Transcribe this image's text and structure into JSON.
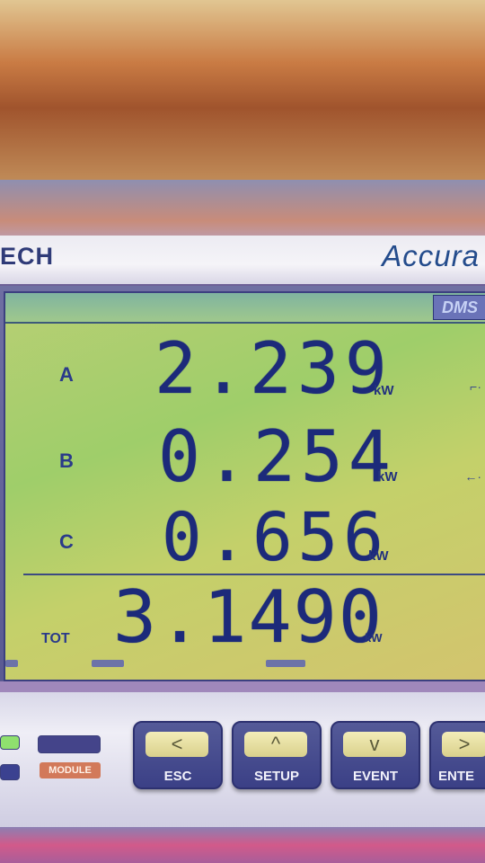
{
  "device": {
    "brand_left": "ECH",
    "brand_right": "Accura",
    "badge": "DMS"
  },
  "readings": [
    {
      "phase": "A",
      "value": "2.239",
      "unit": "kW"
    },
    {
      "phase": "B",
      "value": "0.254",
      "unit": "kW"
    },
    {
      "phase": "C",
      "value": "0.656",
      "unit": "kW"
    }
  ],
  "total": {
    "label": "TOT",
    "value": "3.1490",
    "unit": "kW"
  },
  "buttons": {
    "module_label": "MODULE",
    "esc": {
      "label": "ESC",
      "icon": "chevron-left-icon",
      "glyph": "<"
    },
    "setup": {
      "label": "SETUP",
      "icon": "chevron-up-icon",
      "glyph": "^"
    },
    "event": {
      "label": "EVENT",
      "icon": "chevron-down-icon",
      "glyph": "v"
    },
    "enter": {
      "label": "ENTE",
      "icon": "chevron-right-icon",
      "glyph": ">"
    }
  },
  "colors": {
    "lcd_background": "#a8cf6c",
    "segment_digits": "#1c2a7a",
    "key_body": "#3b4086",
    "module_label": "#d2795a"
  }
}
